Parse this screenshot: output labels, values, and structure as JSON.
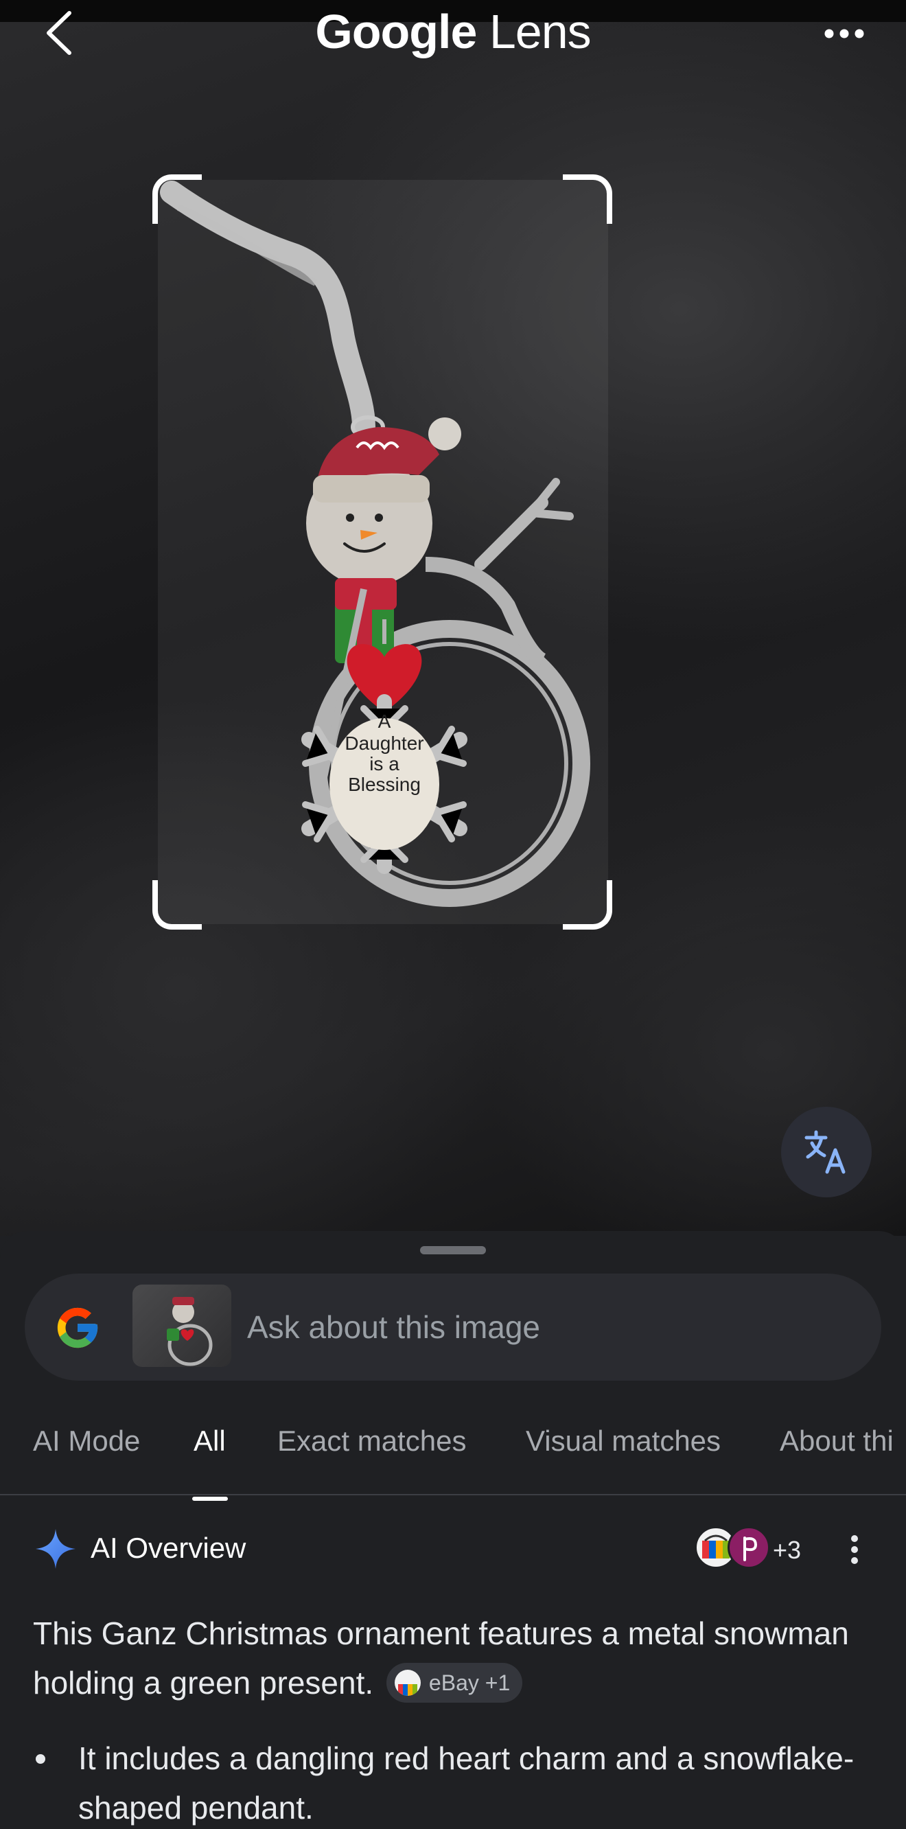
{
  "header": {
    "title_brand": "Google",
    "title_product": "Lens",
    "back_icon": "chevron-left-icon",
    "menu_icon": "more-horizontal-icon"
  },
  "image": {
    "ornament_lines": [
      "A",
      "Daughter",
      "is a",
      "Blessing"
    ]
  },
  "translate_button": {
    "icon": "translate-icon"
  },
  "search": {
    "placeholder": "Ask about this image",
    "value": ""
  },
  "tabs": [
    {
      "label": "AI Mode",
      "active": false
    },
    {
      "label": "All",
      "active": true
    },
    {
      "label": "Exact matches",
      "active": false
    },
    {
      "label": "Visual matches",
      "active": false
    },
    {
      "label": "About thi",
      "active": false
    }
  ],
  "ai_overview": {
    "title": "AI Overview",
    "source_count": "+3",
    "summary": "This Ganz Christmas ornament features a metal snowman holding a green present.",
    "summary_chip": "eBay +1",
    "bullets": [
      "It includes a dangling red heart charm and a snowflake-shaped pendant."
    ]
  },
  "colors": {
    "sheet_background": "#1f2023",
    "search_background": "#2a2b30",
    "tab_inactive": "#a8abb0",
    "tab_active": "#ffffff",
    "sparkle": "#4f8df5"
  }
}
